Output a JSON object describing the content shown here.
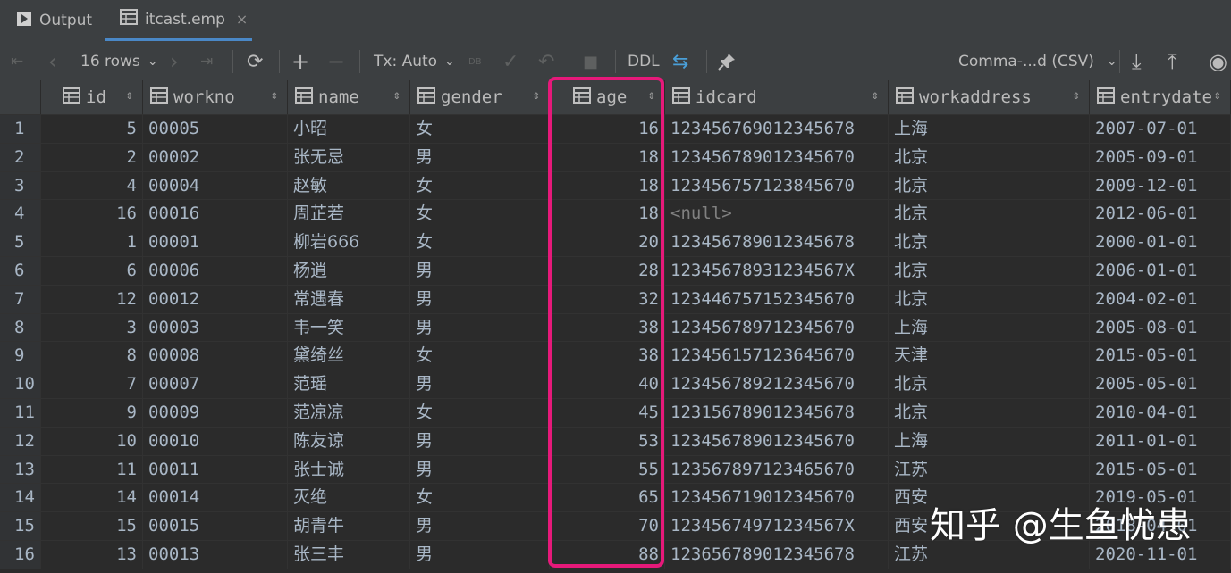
{
  "tabs": [
    {
      "label": "Output",
      "icon": "play-icon"
    },
    {
      "label": "itcast.emp",
      "icon": "table-icon",
      "close": "×"
    }
  ],
  "toolbar": {
    "first": "⇤",
    "prev": "‹",
    "rows": "16 rows",
    "rows_caret": "⌄",
    "next": "›",
    "last": "⇥",
    "refresh": "⟳",
    "add": "+",
    "remove": "−",
    "tx": "Tx: Auto",
    "tx_caret": "⌄",
    "db": "DB",
    "commit": "✓",
    "rollback": "↶",
    "stop": "■",
    "ddl": "DDL",
    "compare": "⇆",
    "pin": "📌",
    "format": "Comma-...d (CSV)",
    "format_caret": "⌄",
    "download": "⤓",
    "upload": "⤒",
    "view": "◉"
  },
  "columns": [
    "id",
    "workno",
    "name",
    "gender",
    "age",
    "idcard",
    "workaddress",
    "entrydate"
  ],
  "rows": [
    {
      "n": "1",
      "id": "5",
      "workno": "00005",
      "name": "小昭",
      "gender": "女",
      "age": "16",
      "idcard": "123456769012345678",
      "workaddress": "上海",
      "entrydate": "2007-07-01"
    },
    {
      "n": "2",
      "id": "2",
      "workno": "00002",
      "name": "张无忌",
      "gender": "男",
      "age": "18",
      "idcard": "123456789012345670",
      "workaddress": "北京",
      "entrydate": "2005-09-01"
    },
    {
      "n": "3",
      "id": "4",
      "workno": "00004",
      "name": "赵敏",
      "gender": "女",
      "age": "18",
      "idcard": "123456757123845670",
      "workaddress": "北京",
      "entrydate": "2009-12-01"
    },
    {
      "n": "4",
      "id": "16",
      "workno": "00016",
      "name": "周芷若",
      "gender": "女",
      "age": "18",
      "idcard": "<null>",
      "workaddress": "北京",
      "entrydate": "2012-06-01"
    },
    {
      "n": "5",
      "id": "1",
      "workno": "00001",
      "name": "柳岩666",
      "gender": "女",
      "age": "20",
      "idcard": "123456789012345678",
      "workaddress": "北京",
      "entrydate": "2000-01-01"
    },
    {
      "n": "6",
      "id": "6",
      "workno": "00006",
      "name": "杨逍",
      "gender": "男",
      "age": "28",
      "idcard": "12345678931234567X",
      "workaddress": "北京",
      "entrydate": "2006-01-01"
    },
    {
      "n": "7",
      "id": "12",
      "workno": "00012",
      "name": "常遇春",
      "gender": "男",
      "age": "32",
      "idcard": "123446757152345670",
      "workaddress": "北京",
      "entrydate": "2004-02-01"
    },
    {
      "n": "8",
      "id": "3",
      "workno": "00003",
      "name": "韦一笑",
      "gender": "男",
      "age": "38",
      "idcard": "123456789712345670",
      "workaddress": "上海",
      "entrydate": "2005-08-01"
    },
    {
      "n": "9",
      "id": "8",
      "workno": "00008",
      "name": "黛绮丝",
      "gender": "女",
      "age": "38",
      "idcard": "123456157123645670",
      "workaddress": "天津",
      "entrydate": "2015-05-01"
    },
    {
      "n": "10",
      "id": "7",
      "workno": "00007",
      "name": "范瑶",
      "gender": "男",
      "age": "40",
      "idcard": "123456789212345670",
      "workaddress": "北京",
      "entrydate": "2005-05-01"
    },
    {
      "n": "11",
      "id": "9",
      "workno": "00009",
      "name": "范凉凉",
      "gender": "女",
      "age": "45",
      "idcard": "123156789012345678",
      "workaddress": "北京",
      "entrydate": "2010-04-01"
    },
    {
      "n": "12",
      "id": "10",
      "workno": "00010",
      "name": "陈友谅",
      "gender": "男",
      "age": "53",
      "idcard": "123456789012345670",
      "workaddress": "上海",
      "entrydate": "2011-01-01"
    },
    {
      "n": "13",
      "id": "11",
      "workno": "00011",
      "name": "张士诚",
      "gender": "男",
      "age": "55",
      "idcard": "123567897123465670",
      "workaddress": "江苏",
      "entrydate": "2015-05-01"
    },
    {
      "n": "14",
      "id": "14",
      "workno": "00014",
      "name": "灭绝",
      "gender": "女",
      "age": "65",
      "idcard": "123456719012345670",
      "workaddress": "西安",
      "entrydate": "2019-05-01"
    },
    {
      "n": "15",
      "id": "15",
      "workno": "00015",
      "name": "胡青牛",
      "gender": "男",
      "age": "70",
      "idcard": "12345674971234567X",
      "workaddress": "西安",
      "entrydate": "2018-04-01"
    },
    {
      "n": "16",
      "id": "13",
      "workno": "00013",
      "name": "张三丰",
      "gender": "男",
      "age": "88",
      "idcard": "123656789012345678",
      "workaddress": "江苏",
      "entrydate": "2020-11-01"
    }
  ],
  "watermark": "知乎 @生鱼忧患",
  "colors": {
    "highlight": "#e6197a",
    "accent": "#4a88c7"
  }
}
